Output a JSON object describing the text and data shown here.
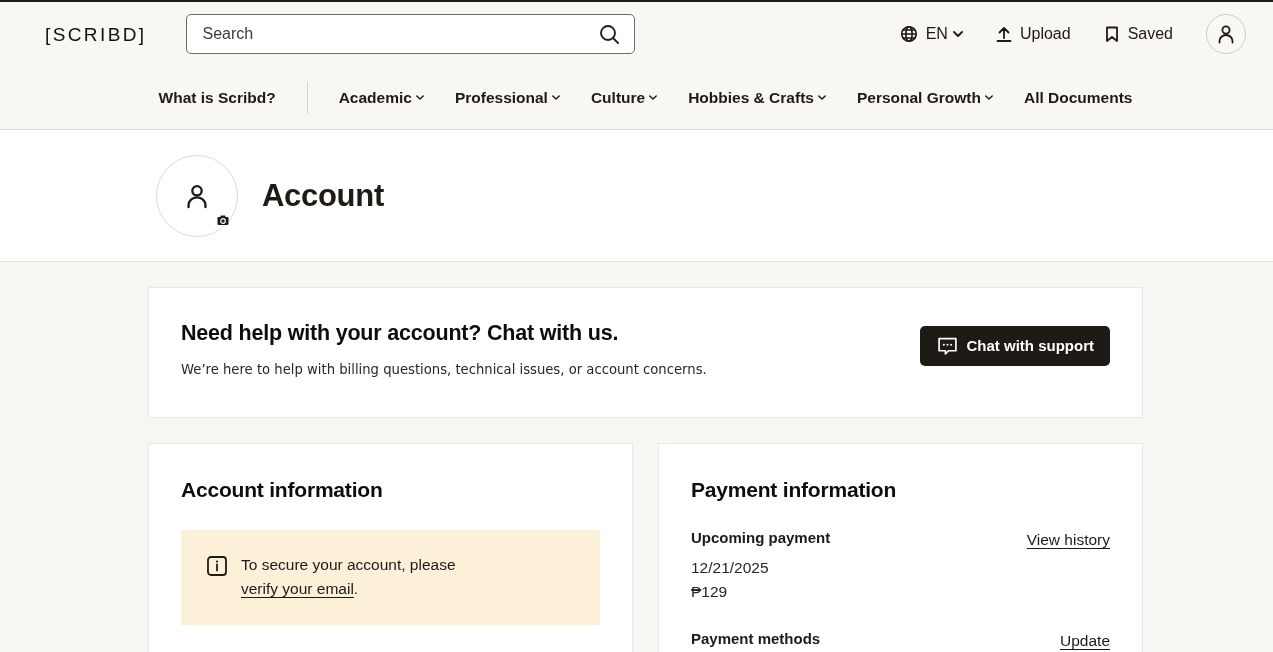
{
  "header": {
    "logo": "[SCRIBD]",
    "search": {
      "placeholder": "Search"
    },
    "language": {
      "label": "EN"
    },
    "actions": [
      {
        "label": "Upload",
        "kind": "upload"
      },
      {
        "label": "Saved",
        "kind": "saved"
      }
    ]
  },
  "nav": {
    "intro": "What is Scribd?",
    "categories": [
      {
        "label": "Academic",
        "dropdown": true
      },
      {
        "label": "Professional",
        "dropdown": true
      },
      {
        "label": "Culture",
        "dropdown": true
      },
      {
        "label": "Hobbies & Crafts",
        "dropdown": true
      },
      {
        "label": "Personal Growth",
        "dropdown": true
      },
      {
        "label": "All Documents",
        "dropdown": false
      }
    ]
  },
  "profile": {
    "title": "Account"
  },
  "help_card": {
    "title": "Need help with your account? Chat with us.",
    "text": "We’re here to help with billing questions, technical issues, or account concerns.",
    "button": "Chat with support"
  },
  "account_card": {
    "title": "Account information",
    "alert": {
      "text": "To secure your account, please",
      "link": "verify your email",
      "after": "."
    }
  },
  "payment_card": {
    "title": "Payment information",
    "sections": [
      {
        "label": "Upcoming payment",
        "link": "View history",
        "lines": [
          "12/21/2025",
          "₱129"
        ]
      },
      {
        "label": "Payment methods",
        "link": "Update"
      }
    ]
  }
}
